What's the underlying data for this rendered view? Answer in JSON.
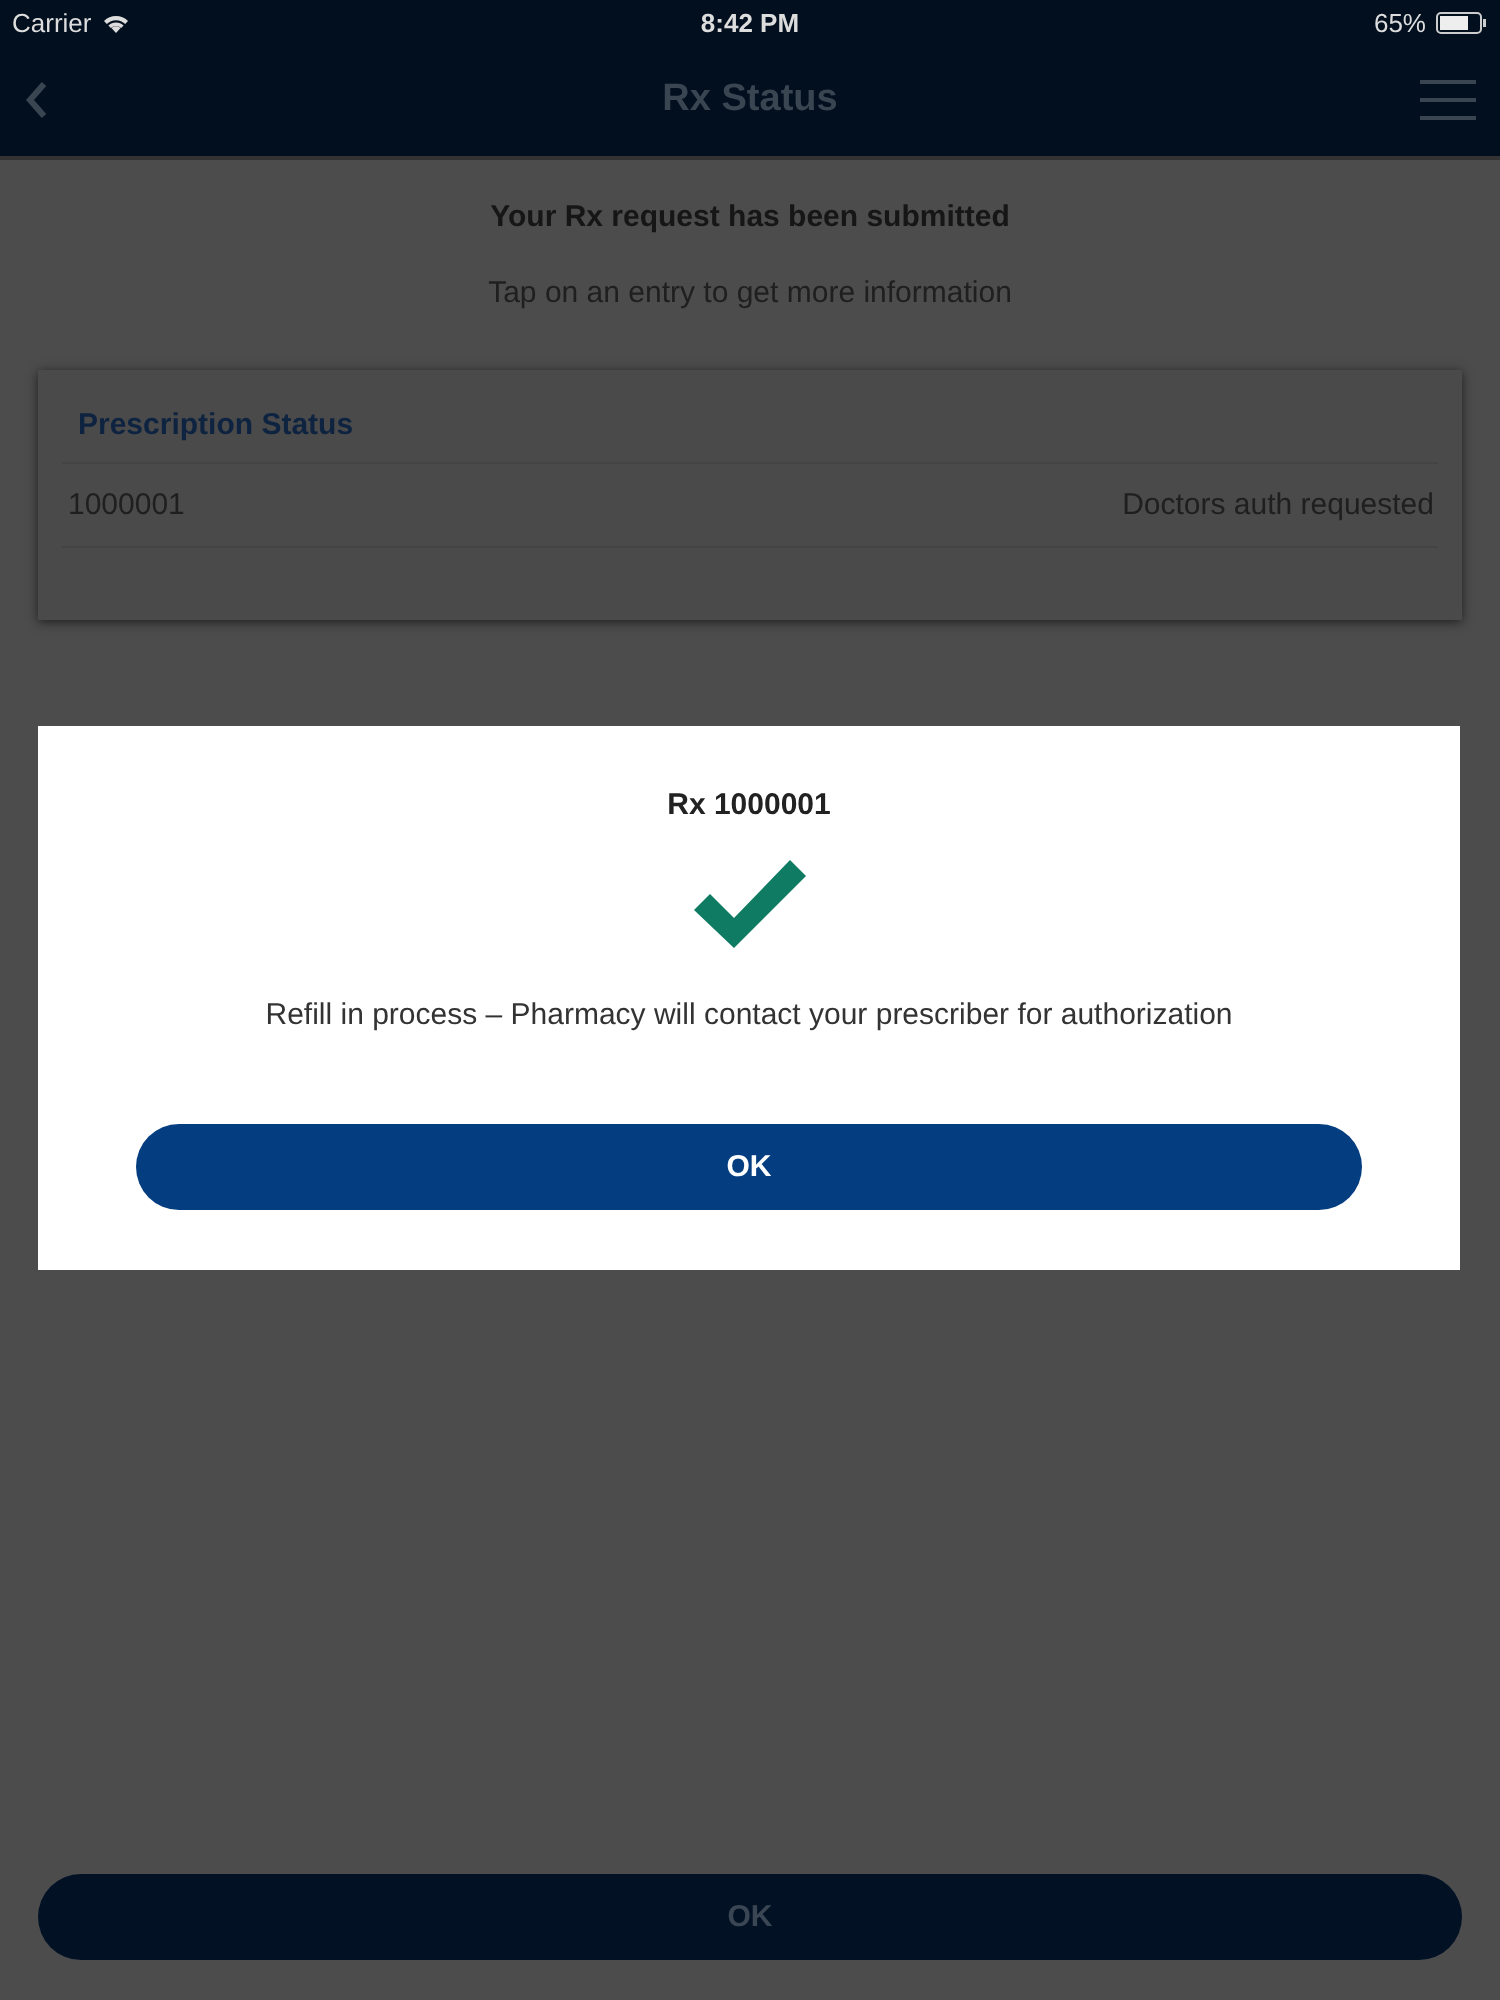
{
  "status_bar": {
    "carrier": "Carrier",
    "time": "8:42 PM",
    "battery": "65%"
  },
  "nav": {
    "title": "Rx Status"
  },
  "heading": "Your Rx request has been submitted",
  "subheading": "Tap on an entry to get more information",
  "card": {
    "title": "Prescription Status",
    "rows": [
      {
        "number": "1000001",
        "status": "Doctors auth requested"
      }
    ]
  },
  "dialog": {
    "title": "Rx 1000001",
    "message": "Refill in process – Pharmacy will contact your prescriber for authorization",
    "button": "OK"
  },
  "footer_button": "OK"
}
